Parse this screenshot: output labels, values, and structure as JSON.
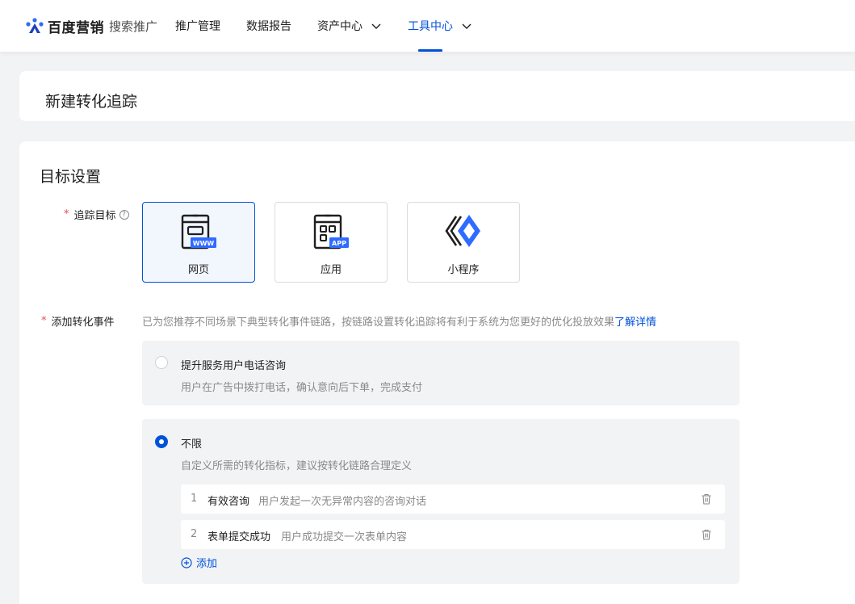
{
  "header": {
    "brand": "百度营销",
    "product": "搜索推广",
    "nav": [
      {
        "label": "推广管理",
        "dropdown": false,
        "active": false
      },
      {
        "label": "数据报告",
        "dropdown": false,
        "active": false
      },
      {
        "label": "资产中心",
        "dropdown": true,
        "active": false
      },
      {
        "label": "工具中心",
        "dropdown": true,
        "active": true
      }
    ]
  },
  "page": {
    "title": "新建转化追踪"
  },
  "goal": {
    "section_title": "目标设置",
    "target_label": "追踪目标",
    "target_help_icon": "question-circle-icon",
    "targets": [
      {
        "label": "网页",
        "icon": "webpage-www-icon",
        "badge": "WWW",
        "selected": true
      },
      {
        "label": "应用",
        "icon": "app-icon",
        "badge": "APP",
        "selected": false
      },
      {
        "label": "小程序",
        "icon": "mini-program-icon",
        "selected": false
      }
    ],
    "event_label": "添加转化事件",
    "hint": "已为您推荐不同场景下典型转化事件链路，按链路设置转化追踪将有利于系统为您更好的优化投放效果",
    "hint_link": "了解详情",
    "options": [
      {
        "title": "提升服务用户电话咨询",
        "desc": "用户在广告中拨打电话，确认意向后下单，完成支付",
        "selected": false
      },
      {
        "title": "不限",
        "desc": "自定义所需的转化指标，建议按转化链路合理定义",
        "selected": true
      }
    ],
    "events": [
      {
        "num": "1",
        "name": "有效咨询",
        "desc": "用户发起一次无异常内容的咨询对话"
      },
      {
        "num": "2",
        "name": "表单提交成功",
        "desc": "用户成功提交一次表单内容"
      }
    ],
    "add_label": "添加"
  },
  "colors": {
    "accent": "#0052d9",
    "required": "#e34d59",
    "muted": "#8a8a8a",
    "bg": "#f2f3f5"
  }
}
